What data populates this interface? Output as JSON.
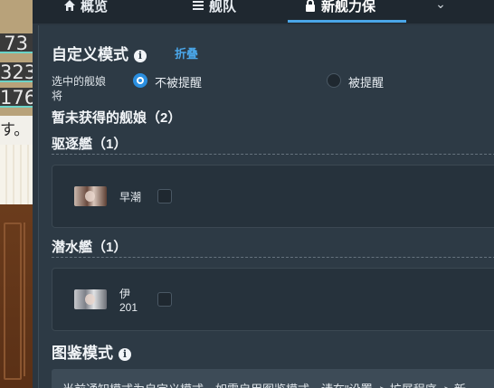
{
  "background": {
    "numbers": [
      "73",
      "323",
      "176"
    ],
    "text": "す。"
  },
  "nav": {
    "tabs": [
      {
        "label": "概览",
        "icon": "home-icon"
      },
      {
        "label": "舰队",
        "icon": "list-icon"
      },
      {
        "label": "新舰力保",
        "icon": "lock-icon",
        "active": true
      }
    ],
    "more_icon": "chevron-down-icon"
  },
  "custom_mode": {
    "title": "自定义模式",
    "collapse": "折叠",
    "selected_label": "选中的舰娘将",
    "options": [
      {
        "label": "不被提醒",
        "selected": true
      },
      {
        "label": "被提醒",
        "selected": false
      }
    ]
  },
  "unobtained": {
    "title": "暂未获得的舰娘（2）",
    "groups": [
      {
        "title": "驱逐艦（1）",
        "ships": [
          {
            "name": "早潮",
            "checked": false
          }
        ]
      },
      {
        "title": "潜水艦（1）",
        "ships": [
          {
            "name": "伊201",
            "checked": false
          }
        ]
      }
    ]
  },
  "zukan_mode": {
    "title": "图鉴模式",
    "notice": "当前通知模式为自定义模式，如需启用图鉴模式，请在\"设置 -> 扩展程序 -> 新"
  },
  "colors": {
    "accent": "#4aa6e8",
    "panel": "#2d3a45",
    "nav": "#1f2830"
  }
}
